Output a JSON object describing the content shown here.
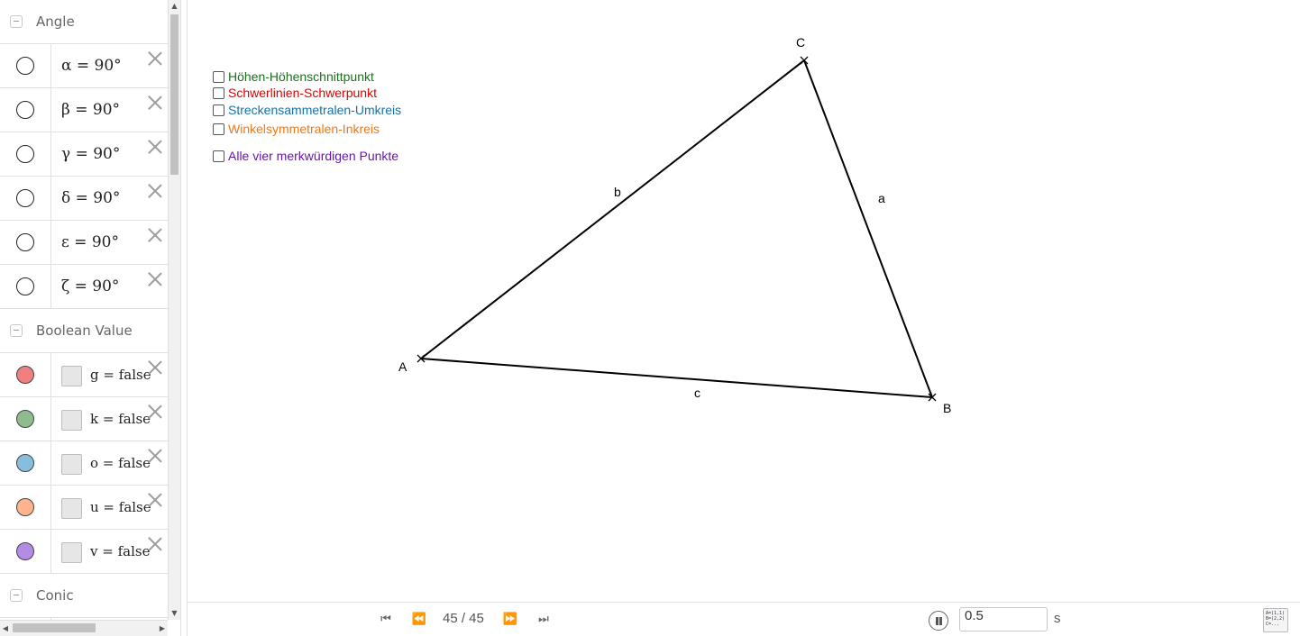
{
  "algebra": {
    "groups": [
      {
        "title": "Angle",
        "rows": [
          {
            "expr": "α = 90°"
          },
          {
            "expr": "β = 90°"
          },
          {
            "expr": "γ = 90°"
          },
          {
            "expr": "δ = 90°"
          },
          {
            "expr": "ε = 90°"
          },
          {
            "expr": "ζ = 90°"
          }
        ]
      },
      {
        "title": "Boolean Value",
        "rows": [
          {
            "expr": "g = false",
            "color": "#f08080"
          },
          {
            "expr": "k = false",
            "color": "#8fbc8f"
          },
          {
            "expr": "o = false",
            "color": "#87bedc"
          },
          {
            "expr": "u = false",
            "color": "#ffb48c"
          },
          {
            "expr": "v = false",
            "color": "#b48ce6"
          }
        ]
      },
      {
        "title": "Conic",
        "rows": []
      }
    ]
  },
  "graphics": {
    "checkboxes": [
      {
        "label": "Höhen-Höhenschnittpunkt",
        "color": "#1e6e1e"
      },
      {
        "label": "Schwerlinien-Schwerpunkt",
        "color": "#e00000"
      },
      {
        "label": "Streckensammetralen-Umkreis",
        "color": "#1673a6"
      },
      {
        "label": "Winkelsymmetralen-Inkreis",
        "color": "#f07814"
      },
      {
        "label": "Alle vier merkwürdigen Punkte",
        "color": "#6a14b4"
      }
    ],
    "points": {
      "A": "A",
      "B": "B",
      "C": "C"
    },
    "segments": {
      "a": "a",
      "b": "b",
      "c": "c"
    }
  },
  "animation": {
    "frame": "45 / 45",
    "speed": "0.5",
    "unit": "s",
    "algebra_icon_text": [
      "A=(1,1)",
      "B=(2,2)",
      "C=..."
    ]
  }
}
